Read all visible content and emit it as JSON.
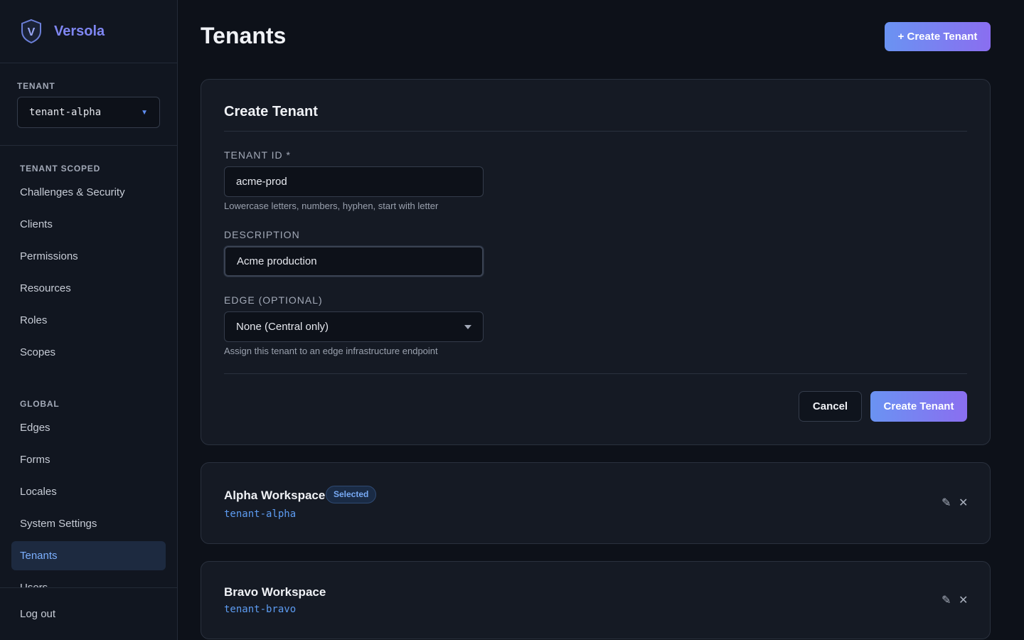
{
  "brand": {
    "name": "Versola",
    "logo_letter": "V"
  },
  "tenant_picker": {
    "label": "TENANT",
    "value": "tenant-alpha"
  },
  "nav": {
    "tenant_scoped_label": "TENANT SCOPED",
    "tenant_scoped": [
      {
        "label": "Challenges & Security"
      },
      {
        "label": "Clients"
      },
      {
        "label": "Permissions"
      },
      {
        "label": "Resources"
      },
      {
        "label": "Roles"
      },
      {
        "label": "Scopes"
      }
    ],
    "global_label": "GLOBAL",
    "global": [
      {
        "label": "Edges"
      },
      {
        "label": "Forms"
      },
      {
        "label": "Locales"
      },
      {
        "label": "System Settings"
      },
      {
        "label": "Tenants"
      },
      {
        "label": "Users"
      }
    ],
    "active": "Tenants",
    "logout": "Log out"
  },
  "header": {
    "title": "Tenants",
    "create_button": "+ Create Tenant"
  },
  "form": {
    "title": "Create Tenant",
    "tenant_id": {
      "label": "TENANT ID *",
      "value": "acme-prod",
      "help": "Lowercase letters, numbers, hyphen, start with letter"
    },
    "description": {
      "label": "DESCRIPTION",
      "value": "Acme production"
    },
    "edge": {
      "label": "EDGE (OPTIONAL)",
      "value": "None (Central only)",
      "help": "Assign this tenant to an edge infrastructure endpoint"
    },
    "cancel_button": "Cancel",
    "submit_button": "Create Tenant"
  },
  "tenants": [
    {
      "name": "Alpha Workspace",
      "id": "tenant-alpha",
      "badge": "Selected"
    },
    {
      "name": "Bravo Workspace",
      "id": "tenant-bravo"
    }
  ],
  "icons": {
    "edit": "pencil-icon",
    "delete": "close-icon",
    "dropdown": "chevron-down-icon"
  },
  "colors": {
    "accent": "#7f86f2",
    "link": "#5d9cf2",
    "active_nav_bg": "#1d2a40"
  }
}
